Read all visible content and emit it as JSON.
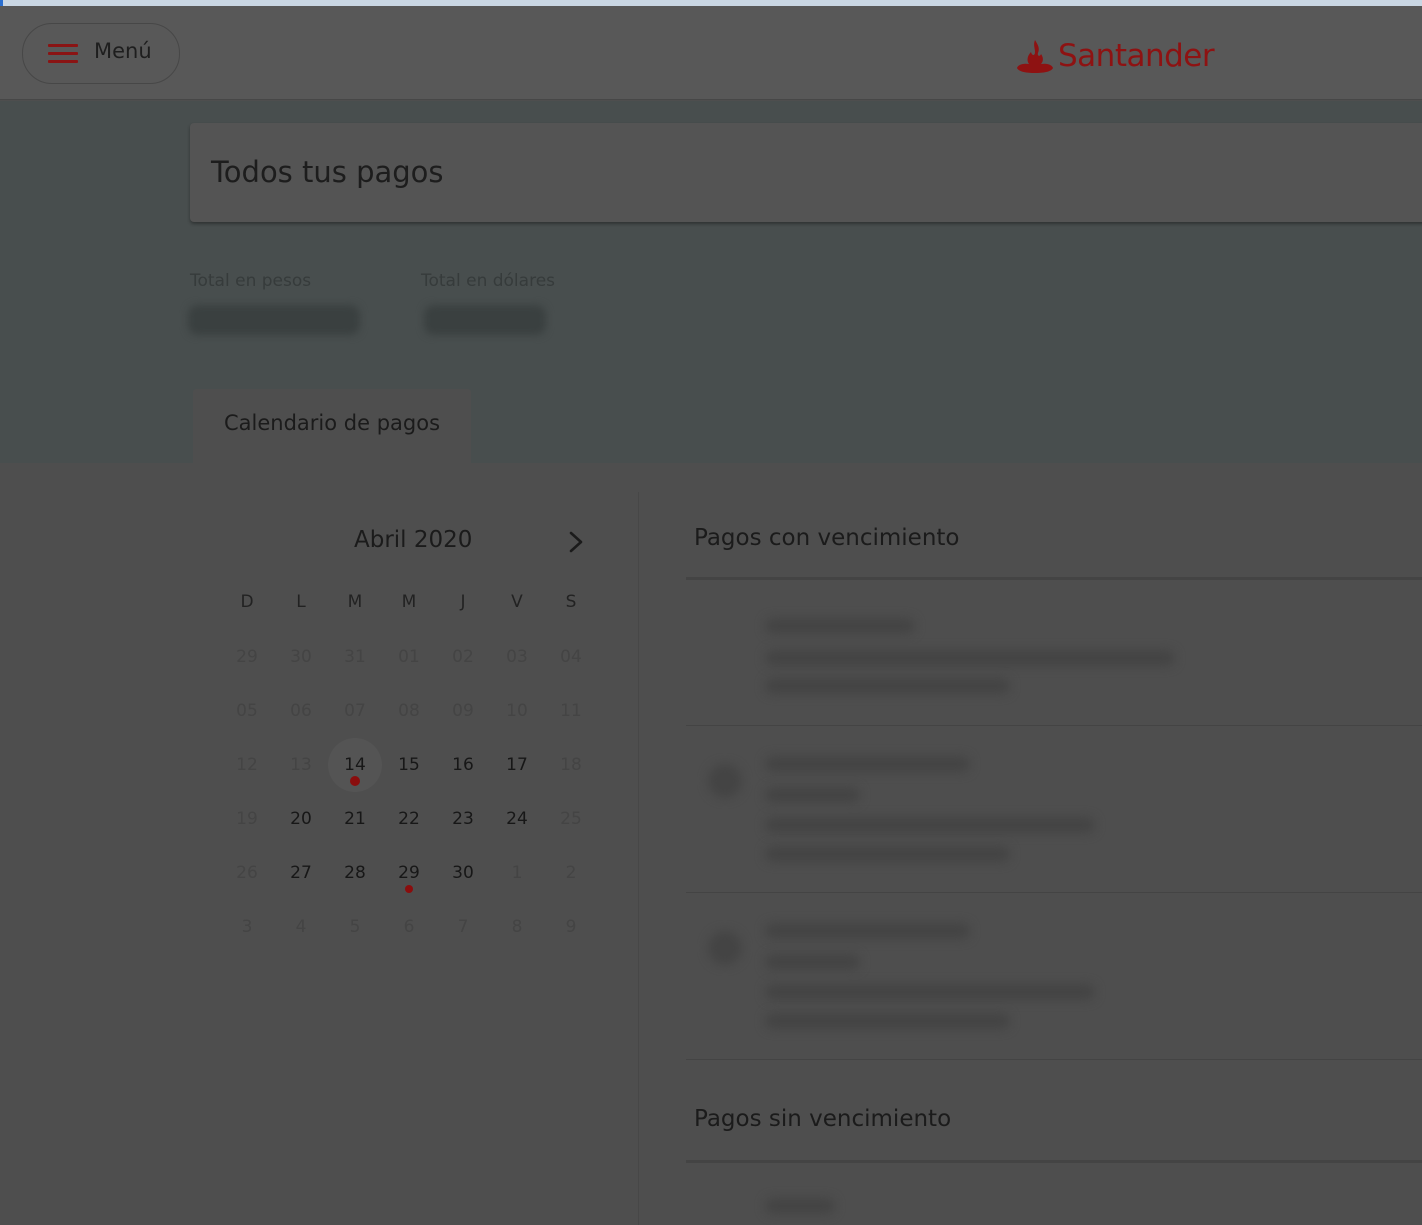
{
  "header": {
    "menu_label": "Menú",
    "brand": "Santander",
    "brand_color": "#8e1212"
  },
  "page": {
    "title": "Todos tus pagos",
    "total_pesos_label": "Total en pesos",
    "total_dolares_label": "Total en dólares",
    "tab_label": "Calendario de pagos"
  },
  "calendar": {
    "month_label": "Abril 2020",
    "next_icon": "chevron-right-icon",
    "weekdays": [
      "D",
      "L",
      "M",
      "M",
      "J",
      "V",
      "S"
    ],
    "weeks": [
      [
        "29",
        "30",
        "31",
        "01",
        "02",
        "03",
        "04"
      ],
      [
        "05",
        "06",
        "07",
        "08",
        "09",
        "10",
        "11"
      ],
      [
        "12",
        "13",
        "14",
        "15",
        "16",
        "17",
        "18"
      ],
      [
        "19",
        "20",
        "21",
        "22",
        "23",
        "24",
        "25"
      ],
      [
        "26",
        "27",
        "28",
        "29",
        "30",
        "1",
        "2"
      ],
      [
        "3",
        "4",
        "5",
        "6",
        "7",
        "8",
        "9"
      ]
    ],
    "selected_day": "14",
    "days_with_payments": [
      "14",
      "29"
    ],
    "dot_color": "#8a0d0d"
  },
  "payments": {
    "with_due_title": "Pagos con vencimiento",
    "without_due_title": "Pagos sin vencimiento"
  }
}
